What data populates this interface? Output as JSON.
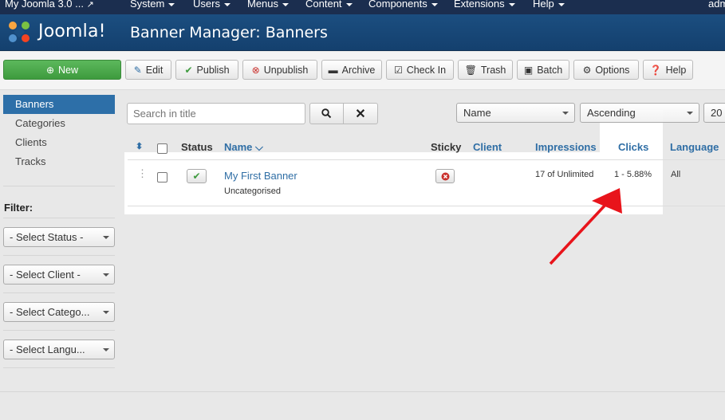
{
  "topnav": {
    "site": "My Joomla 3.0 ...",
    "menus": [
      "System",
      "Users",
      "Menus",
      "Content",
      "Components",
      "Extensions",
      "Help"
    ],
    "user": "adm"
  },
  "header": {
    "logo_text": "Joomla!",
    "title": "Banner Manager: Banners"
  },
  "toolbar": {
    "new": "New",
    "edit": "Edit",
    "publish": "Publish",
    "unpublish": "Unpublish",
    "archive": "Archive",
    "checkin": "Check In",
    "trash": "Trash",
    "batch": "Batch",
    "options": "Options",
    "help": "Help"
  },
  "sidebar": {
    "items": [
      "Banners",
      "Categories",
      "Clients",
      "Tracks"
    ],
    "filter_label": "Filter:",
    "filters": [
      "- Select Status -",
      "- Select Client -",
      "- Select Catego...",
      "- Select Langu..."
    ]
  },
  "search": {
    "placeholder": "Search in title"
  },
  "sort": {
    "field": "Name",
    "direction": "Ascending",
    "limit": "20"
  },
  "table": {
    "headers": {
      "status": "Status",
      "name": "Name",
      "sticky": "Sticky",
      "client": "Client",
      "impressions": "Impressions",
      "clicks": "Clicks",
      "language": "Language"
    },
    "rows": [
      {
        "name": "My First Banner",
        "category": "Uncategorised",
        "impressions": "17 of Unlimited",
        "clicks": "1 - 5.88%",
        "language": "All"
      }
    ]
  },
  "colors": {
    "header": "#1b4e80",
    "accent": "#2f6ea5",
    "new_button": "#4cae4c",
    "arrow": "#e8141b"
  }
}
